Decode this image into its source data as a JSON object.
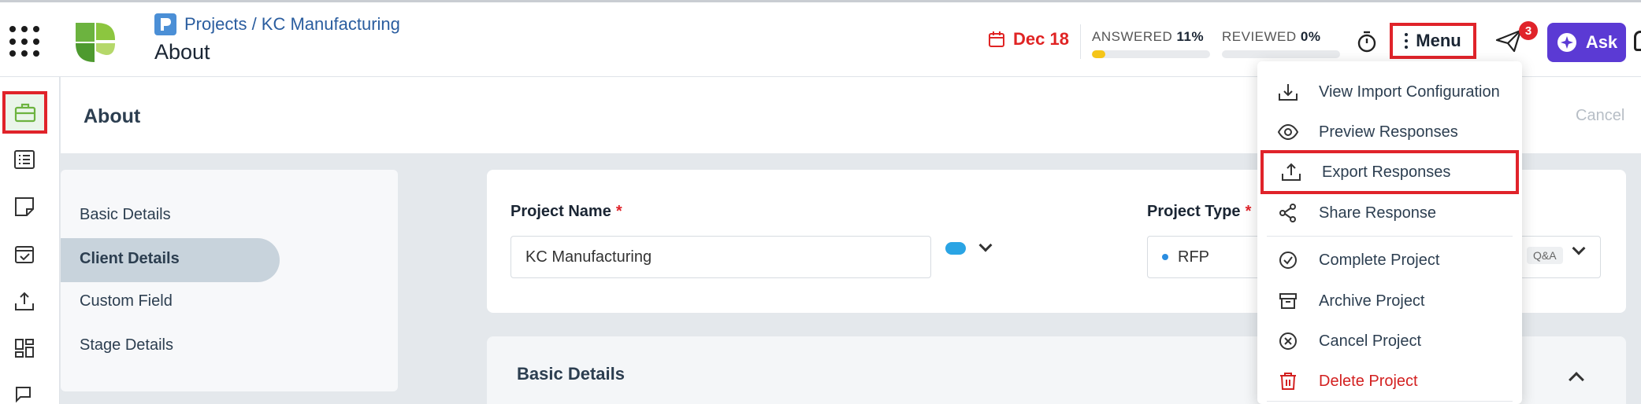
{
  "breadcrumb": {
    "text": "Projects / KC Manufacturing"
  },
  "page": {
    "title": "About"
  },
  "header": {
    "due_date": "Dec 18",
    "answered_label": "ANSWERED",
    "answered_value": "11%",
    "answered_fraction": 0.11,
    "reviewed_label": "REVIEWED",
    "reviewed_value": "0%",
    "reviewed_fraction": 0.0,
    "menu_label": "Menu",
    "notification_count": "3",
    "ask_label": "Ask"
  },
  "section": {
    "title": "About",
    "cancel_label": "Cancel"
  },
  "subnav": {
    "items": [
      {
        "label": "Basic Details"
      },
      {
        "label": "Client Details"
      },
      {
        "label": "Custom Field"
      },
      {
        "label": "Stage Details"
      }
    ],
    "active_index": 1
  },
  "form": {
    "project_name_label": "Project Name",
    "project_name_value": "KC Manufacturing",
    "project_type_label": "Project Type",
    "project_type_value": "RFP",
    "project_type_tag": "Q&A",
    "required_mark": "*"
  },
  "basic_details": {
    "title": "Basic Details"
  },
  "dropdown": {
    "items": [
      {
        "label": "View Import Configuration",
        "icon": "download-icon"
      },
      {
        "label": "Preview Responses",
        "icon": "eye-icon"
      },
      {
        "label": "Export Responses",
        "icon": "upload-icon"
      },
      {
        "label": "Share Response",
        "icon": "share-icon"
      },
      {
        "label": "Complete Project",
        "icon": "check-circle-icon"
      },
      {
        "label": "Archive Project",
        "icon": "archive-icon"
      },
      {
        "label": "Cancel Project",
        "icon": "x-circle-icon"
      },
      {
        "label": "Delete Project",
        "icon": "trash-icon"
      }
    ]
  },
  "colors": {
    "accent_purple": "#5b3ad4",
    "danger_red": "#e0232a",
    "progress_yellow": "#f5c518",
    "logo_green": "#6cb33f"
  }
}
